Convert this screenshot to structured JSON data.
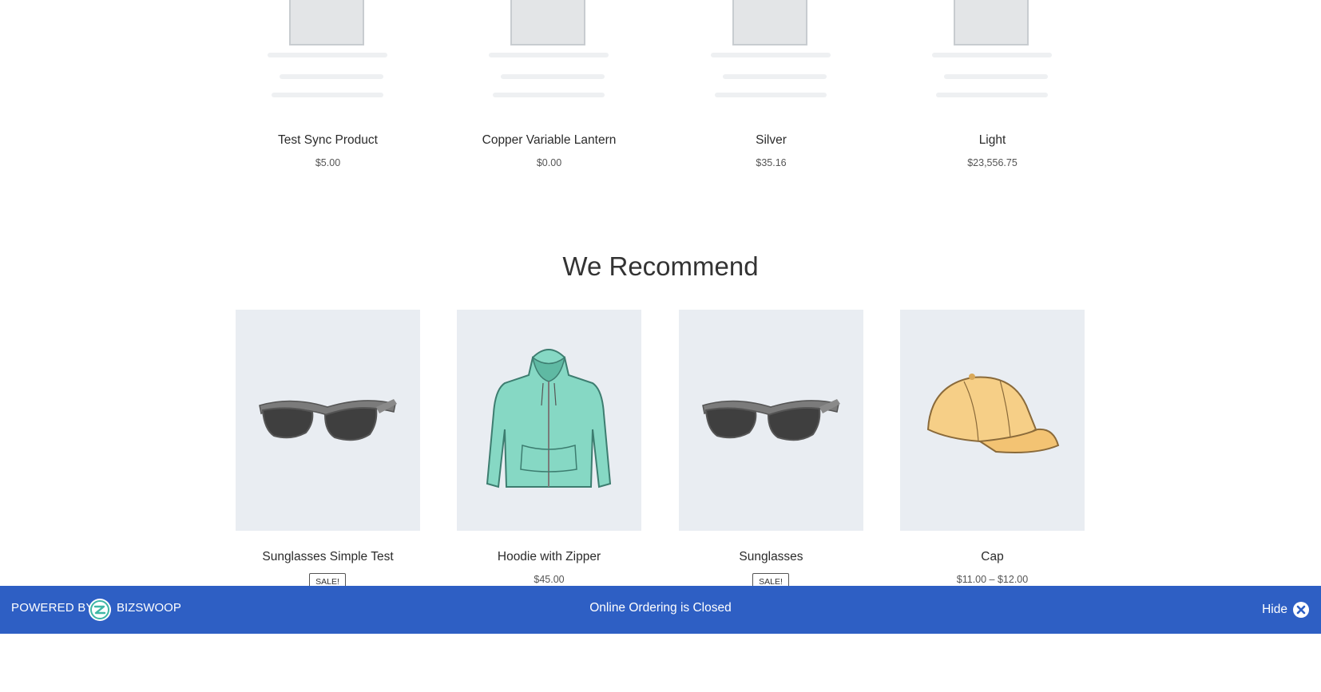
{
  "top_products": [
    {
      "name": "Test Sync Product",
      "price": "$5.00",
      "image": "placeholder-image"
    },
    {
      "name": "Copper Variable Lantern",
      "price": "$0.00",
      "image": "placeholder-image"
    },
    {
      "name": "Silver",
      "price": "$35.16",
      "image": "placeholder-image"
    },
    {
      "name": "Light",
      "price": "$23,556.75",
      "image": "placeholder-image"
    }
  ],
  "recommend": {
    "title": "We Recommend",
    "products": [
      {
        "name": "Sunglasses Simple Test",
        "badge": "SALE!",
        "image": "sunglasses-image"
      },
      {
        "name": "Hoodie with Zipper",
        "price": "$45.00",
        "image": "hoodie-image"
      },
      {
        "name": "Sunglasses",
        "badge": "SALE!",
        "image": "sunglasses-image"
      },
      {
        "name": "Cap",
        "price": "$11.00 – $12.00",
        "image": "cap-image"
      }
    ]
  },
  "footer": {
    "powered_by": "POWERED BY:",
    "brand": "BIZSWOOP",
    "status": "Online Ordering is Closed",
    "hide_label": "Hide",
    "background": "#2e5fc4"
  },
  "colors": {
    "thumb_background": "#e9edf2",
    "placeholder_gray": "#cfd3d6"
  }
}
